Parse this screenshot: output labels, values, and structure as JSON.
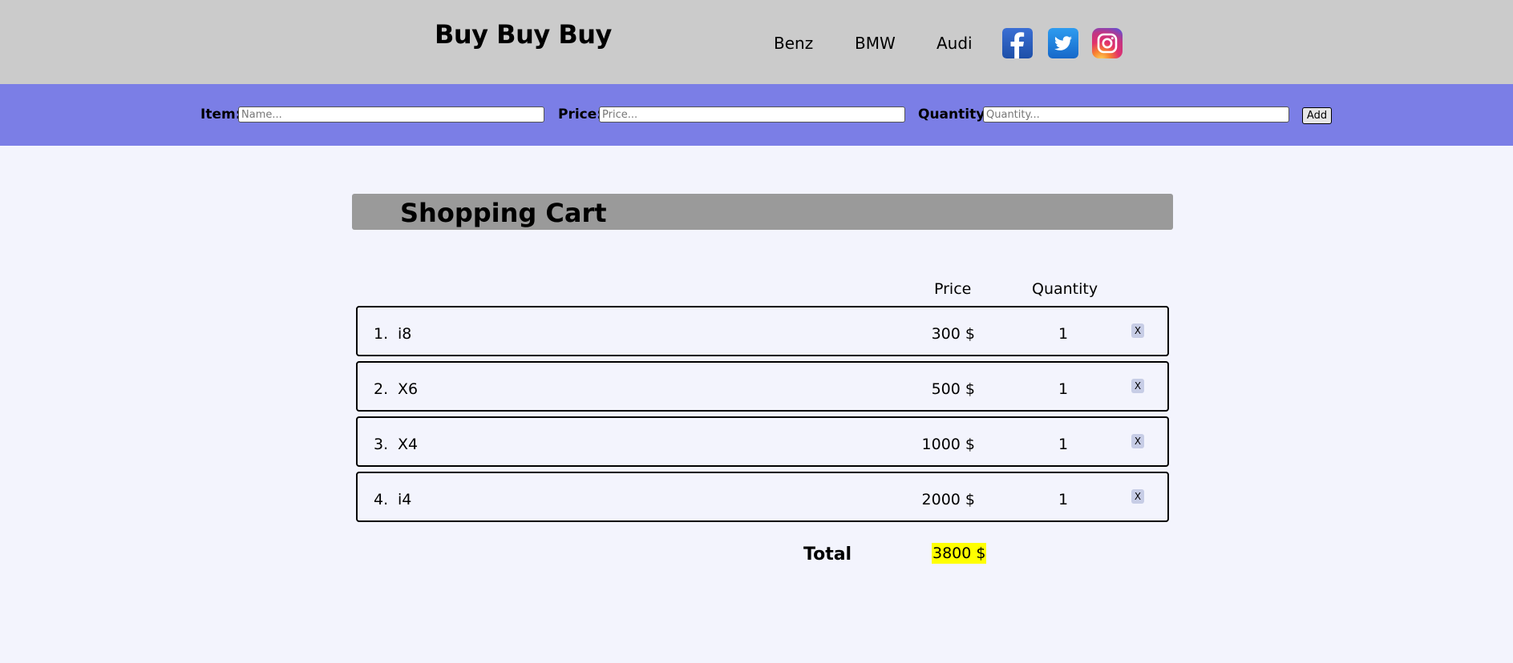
{
  "header": {
    "brand": "Buy Buy Buy",
    "nav": [
      "Benz",
      "BMW",
      "Audi"
    ],
    "social": [
      "facebook-icon",
      "twitter-icon",
      "instagram-icon"
    ]
  },
  "form": {
    "item_label": "Item:",
    "item_placeholder": "Name...",
    "price_label": "Price:",
    "price_placeholder": "Price...",
    "quantity_label": "Quantity:",
    "quantity_placeholder": "Quantity...",
    "add_label": "Add"
  },
  "cart": {
    "title": "Shopping Cart",
    "columns": {
      "price": "Price",
      "quantity": "Quantity"
    },
    "rows": [
      {
        "index": "1.",
        "name": "i8",
        "price": "300 $",
        "quantity": "1",
        "remove": "X"
      },
      {
        "index": "2.",
        "name": "X6",
        "price": "500 $",
        "quantity": "1",
        "remove": "X"
      },
      {
        "index": "3.",
        "name": "X4",
        "price": "1000 $",
        "quantity": "1",
        "remove": "X"
      },
      {
        "index": "4.",
        "name": "i4",
        "price": "2000 $",
        "quantity": "1",
        "remove": "X"
      }
    ],
    "total_label": "Total",
    "total_value": "3800 $"
  },
  "colors": {
    "header_bg": "#cbcbcb",
    "formbar_bg": "#7b7ee6",
    "page_bg": "#f3f4fd",
    "title_bar_bg": "#9a9a9a",
    "total_highlight": "#ffff00"
  }
}
